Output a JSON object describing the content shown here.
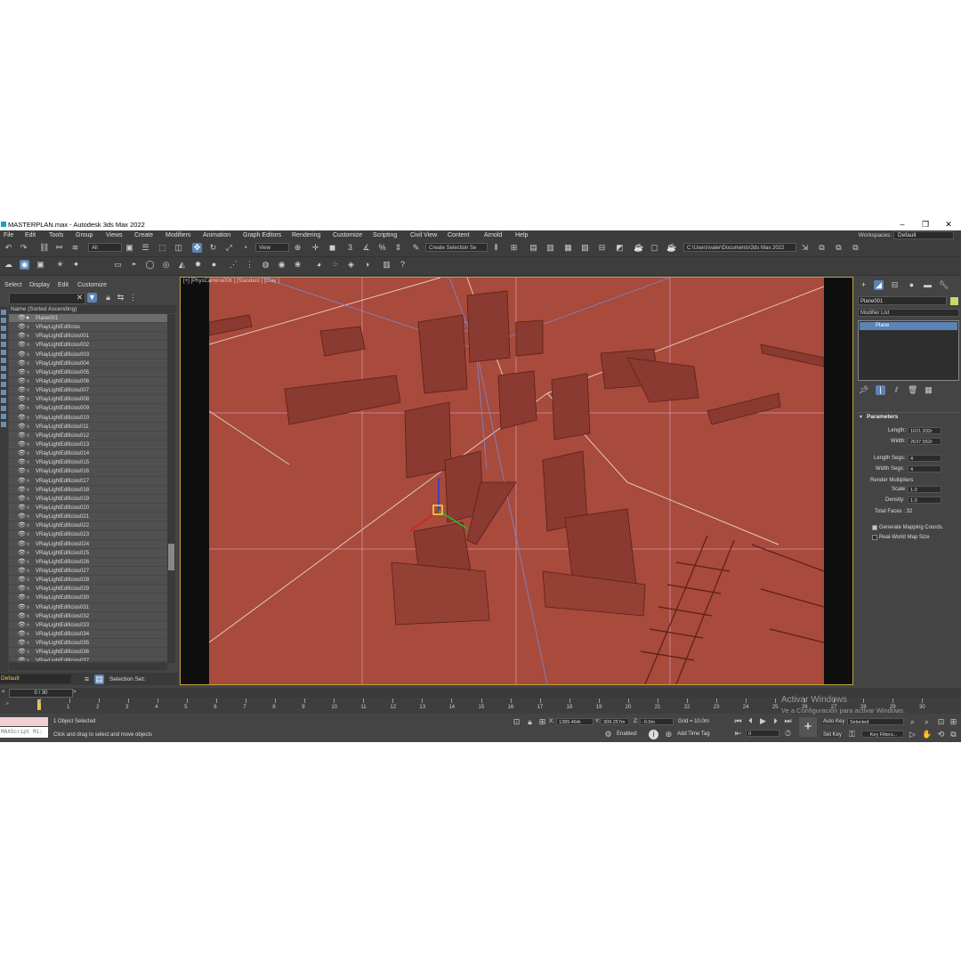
{
  "window": {
    "title": "MASTERPLAN.max - Autodesk 3ds Max 2022",
    "minimize": "–",
    "maximize": "❐",
    "close": "✕"
  },
  "menu": [
    "File",
    "Edit",
    "Tools",
    "Group",
    "Views",
    "Create",
    "Modifiers",
    "Animation",
    "Graph Editors",
    "Rendering",
    "Customize",
    "Scripting",
    "Civil View",
    "Content",
    "Arnold",
    "Help"
  ],
  "workspaces": {
    "label": "Workspaces:",
    "value": "Default"
  },
  "toolbar": {
    "selection_filter": "All",
    "ref_coord": "View",
    "named_selection": "Create Selection Se",
    "project_path": "C:\\Users\\valer\\Documents\\3ds Max 2022"
  },
  "scene_explorer": {
    "tabs": [
      "Select",
      "Display",
      "Edit",
      "Customize"
    ],
    "column_header": "Name (Sorted Ascending)",
    "items": [
      "Plane001",
      "VRayLightEdificios",
      "VRayLightEdificios001",
      "VRayLightEdificios002",
      "VRayLightEdificios003",
      "VRayLightEdificios004",
      "VRayLightEdificios005",
      "VRayLightEdificios006",
      "VRayLightEdificios007",
      "VRayLightEdificios008",
      "VRayLightEdificios009",
      "VRayLightEdificios010",
      "VRayLightEdificios011",
      "VRayLightEdificios012",
      "VRayLightEdificios013",
      "VRayLightEdificios014",
      "VRayLightEdificios015",
      "VRayLightEdificios016",
      "VRayLightEdificios017",
      "VRayLightEdificios018",
      "VRayLightEdificios019",
      "VRayLightEdificios020",
      "VRayLightEdificios021",
      "VRayLightEdificios022",
      "VRayLightEdificios023",
      "VRayLightEdificios024",
      "VRayLightEdificios025",
      "VRayLightEdificios026",
      "VRayLightEdificios027",
      "VRayLightEdificios028",
      "VRayLightEdificios029",
      "VRayLightEdificios030",
      "VRayLightEdificios031",
      "VRayLightEdificios032",
      "VRayLightEdificios033",
      "VRayLightEdificios034",
      "VRayLightEdificios035",
      "VRayLightEdificios036",
      "VRayLightEdificios037"
    ],
    "layer": "Default",
    "selection_set_label": "Selection Set:"
  },
  "viewport": {
    "label": "[+] [PhysCamera006 ] [Standard ] [Clay ]"
  },
  "command_panel": {
    "object_name": "Plane001",
    "modifier_list": "Modifier List",
    "stack_item": "Plane",
    "params_title": "Parameters",
    "length_label": "Length:",
    "length": "1621.932r",
    "width_label": "Width:",
    "width": "2637.552r",
    "length_segs_label": "Length Segs:",
    "length_segs": "4",
    "width_segs_label": "Width Segs:",
    "width_segs": "4",
    "render_mult_label": "Render Multipliers",
    "scale_label": "Scale:",
    "scale": "1.0",
    "density_label": "Density:",
    "density": "1.0",
    "total_faces": "Total Faces : 32",
    "gen_mapping": "Generate Mapping Coords.",
    "real_world": "Real-World Map Size"
  },
  "timeline": {
    "frame": "0 / 30",
    "ticks": [
      "0",
      "1",
      "2",
      "3",
      "4",
      "5",
      "6",
      "7",
      "8",
      "9",
      "10",
      "11",
      "12",
      "13",
      "14",
      "15",
      "16",
      "17",
      "18",
      "19",
      "20",
      "21",
      "22",
      "23",
      "24",
      "25",
      "26",
      "27",
      "28",
      "29",
      "30"
    ]
  },
  "status": {
    "maxscript": "MAXScript Mi:",
    "selected": "1 Object Selected",
    "prompt": "Click and drag to select and move objects",
    "x_label": "X:",
    "x": "1389.464r",
    "y_label": "Y:",
    "y": "309.257m",
    "z_label": "Z:",
    "z": "-0.0m",
    "grid": "Grid = 10.0m",
    "enabled": "Enabled:",
    "add_time_tag": "Add Time Tag",
    "auto_key": "Auto Key",
    "set_key": "Set Key",
    "selected_dropdown": "Selected",
    "key_filters": "Key Filters...",
    "frame_field": "0"
  },
  "watermark": {
    "line1": "Activar Windows",
    "line2": "Ve a Configuración para activar Windows."
  }
}
